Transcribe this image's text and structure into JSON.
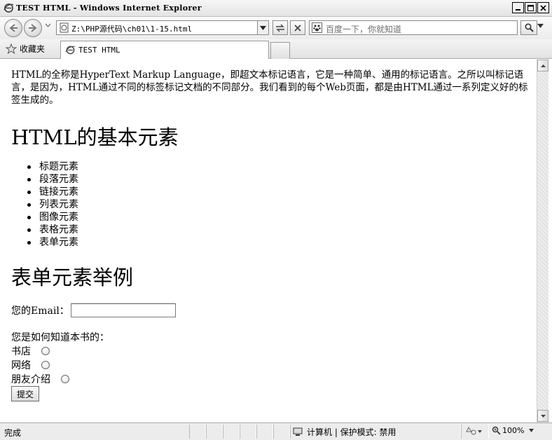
{
  "window": {
    "title": "TEST HTML - Windows Internet Explorer"
  },
  "navigation": {
    "address": "Z:\\PHP源代码\\ch01\\1-15.html",
    "search_placeholder": "百度一下，你就知道"
  },
  "tabs": {
    "favorites_label": "收藏夹",
    "active_tab_title": "TEST HTML"
  },
  "page": {
    "intro": "HTML的全称是HyperText Markup Language，即超文本标记语言，它是一种简单、通用的标记语言。之所以叫标记语言，是因为，HTML通过不同的标签标记文档的不同部分。我们看到的每个Web页面，都是由HTML通过一系列定义好的标签生成的。",
    "heading_elements": "HTML的基本元素",
    "elements": [
      "标题元素",
      "段落元素",
      "链接元素",
      "列表元素",
      "图像元素",
      "表格元素",
      "表单元素"
    ],
    "heading_form": "表单元素举例",
    "email_label": "您的Email：",
    "email_value": "",
    "question": "您是如何知道本书的：",
    "options": [
      "书店",
      "网络",
      "朋友介绍"
    ],
    "submit_label": "提交"
  },
  "status": {
    "text": "完成",
    "zone": "计算机 | 保护模式: 禁用",
    "zoom": "100%"
  }
}
